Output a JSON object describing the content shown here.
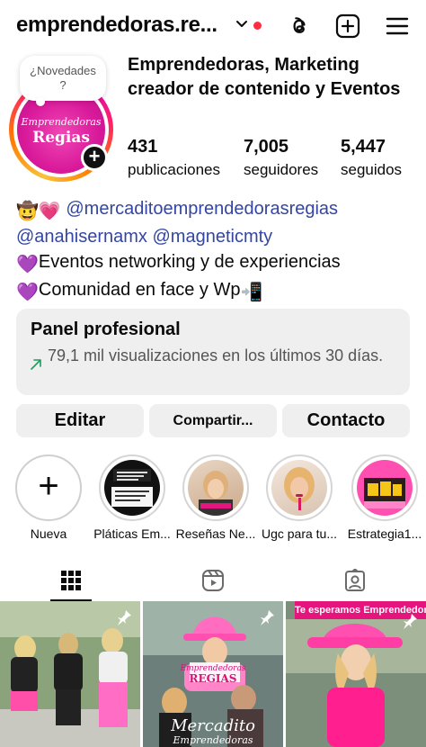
{
  "topbar": {
    "username": "emprendedoras.re...",
    "icons": [
      "chevron-down-icon",
      "threads-icon",
      "new-post-icon",
      "menu-icon"
    ],
    "notification_dot_color": "#ff2d3f"
  },
  "profile": {
    "note": "¿Novedades\n?",
    "avatar_text_script": "Emprendedoras",
    "avatar_text_big": "Regias",
    "display_name": "Emprendedoras, Marketing creador de contenido y Eventos",
    "stats": [
      {
        "value": "431",
        "label": "publicaciones"
      },
      {
        "value": "7,005",
        "label": "seguidores"
      },
      {
        "value": "5,447",
        "label": "seguidos"
      }
    ]
  },
  "bio": {
    "line1_emoji": "🤠💗",
    "mention1": "@mercaditoemprendedorasregias",
    "mention2": "@anahisernamx",
    "mention3": "@magneticmty",
    "line3_emoji": "💜",
    "line3_text": "Eventos networking y de experiencias",
    "line4_emoji": "💜",
    "line4_text": "Comunidad en face y Wp",
    "line4_end_emoji": "📲",
    "link_color": "#3346a3"
  },
  "panel": {
    "title": "Panel profesional",
    "subtitle": "79,1 mil visualizaciones en los últimos 30 días."
  },
  "buttons": {
    "edit": "Editar",
    "share": "Compartir...",
    "contact": "Contacto"
  },
  "highlights": [
    {
      "label": "Nueva"
    },
    {
      "label": "Pláticas Em..."
    },
    {
      "label": "Reseñas Ne..."
    },
    {
      "label": "Ugc para tu..."
    },
    {
      "label": "Estrategia1..."
    }
  ],
  "tabs": [
    "grid-icon",
    "reels-icon",
    "tagged-icon"
  ],
  "grid": {
    "banner_text": "Te esperamos Emprendedorxs",
    "cell2_caption_big": "Mercadito",
    "cell2_caption_small": "Emprendedoras",
    "cell2_logo_script": "Emprendedoras",
    "cell2_logo_big": "REGIAS"
  }
}
